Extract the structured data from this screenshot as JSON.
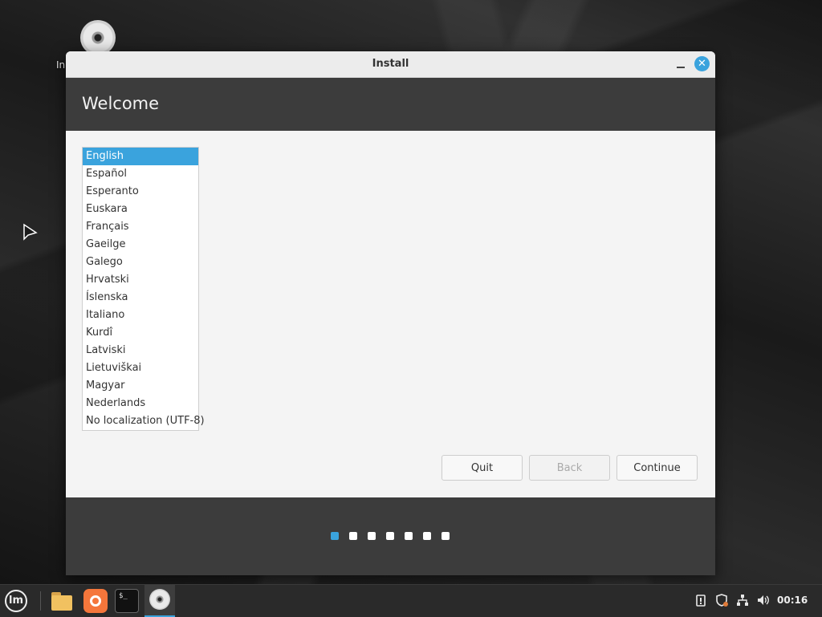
{
  "desktop": {
    "icon_label": "In",
    "icon_name": "cd-drive-icon"
  },
  "window": {
    "title": "Install",
    "close_glyph": "✕",
    "header_title": "Welcome",
    "languages": [
      "English",
      "Español",
      "Esperanto",
      "Euskara",
      "Français",
      "Gaeilge",
      "Galego",
      "Hrvatski",
      "Íslenska",
      "Italiano",
      "Kurdî",
      "Latviski",
      "Lietuviškai",
      "Magyar",
      "Nederlands",
      "No localization (UTF-8)"
    ],
    "selected_language": "English",
    "buttons": {
      "quit": "Quit",
      "back": "Back",
      "continue": "Continue"
    },
    "progress": {
      "total_steps": 7,
      "current_step": 1
    }
  },
  "taskbar": {
    "menu_glyph": "lm",
    "apps": [
      "folder-icon",
      "firefox-icon",
      "terminal-icon",
      "install-icon"
    ],
    "terminal_glyph": "$_",
    "clock": "00:16"
  },
  "colors": {
    "accent": "#3aa3dd",
    "header_bg": "#3c3c3c",
    "window_bg": "#f4f4f4"
  }
}
